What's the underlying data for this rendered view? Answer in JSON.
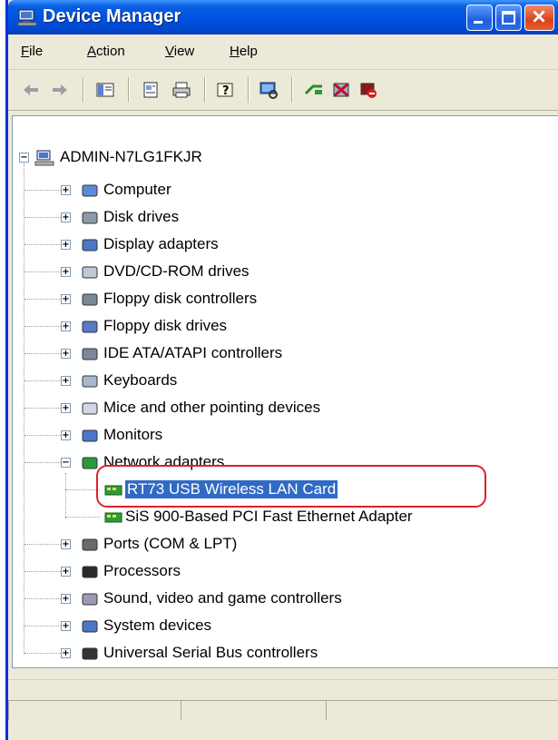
{
  "window": {
    "title": "Device Manager"
  },
  "menu": {
    "file": {
      "u": "F",
      "rest": "ile"
    },
    "action": {
      "u": "A",
      "rest": "ction"
    },
    "view": {
      "u": "V",
      "rest": "iew"
    },
    "help": {
      "u": "H",
      "rest": "elp"
    }
  },
  "tree": {
    "root": "ADMIN-N7LG1FKJR",
    "categories": [
      "Computer",
      "Disk drives",
      "Display adapters",
      "DVD/CD-ROM drives",
      "Floppy disk controllers",
      "Floppy disk drives",
      "IDE ATA/ATAPI controllers",
      "Keyboards",
      "Mice and other pointing devices",
      "Monitors",
      "Network adapters",
      "Ports (COM & LPT)",
      "Processors",
      "Sound, video and game controllers",
      "System devices",
      "Universal Serial Bus controllers"
    ],
    "network_children": [
      "RT73 USB Wireless LAN Card",
      "SiS 900-Based PCI Fast Ethernet Adapter"
    ]
  },
  "colors": {
    "selection": "#316ac5",
    "highlight_ring": "#e0202a",
    "titlebar": "#0054e3"
  }
}
